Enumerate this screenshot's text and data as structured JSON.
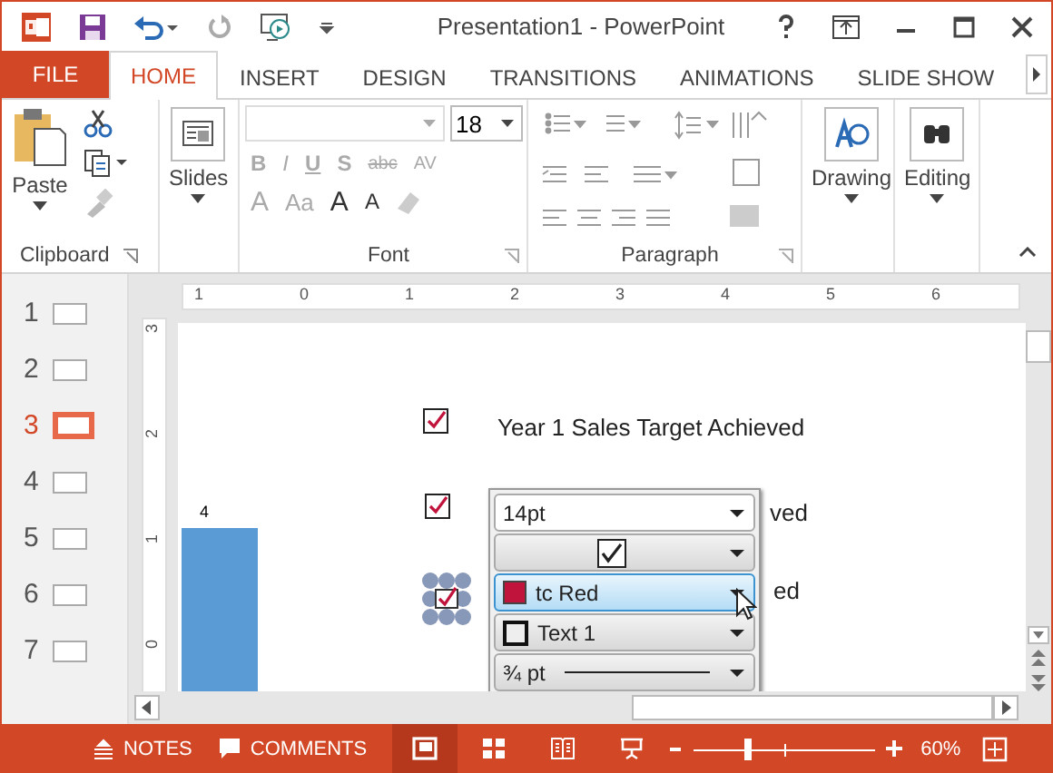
{
  "window": {
    "title": "Presentation1 - PowerPoint"
  },
  "tabs": [
    {
      "label": "FILE",
      "kind": "file",
      "selected": false
    },
    {
      "label": "HOME",
      "kind": "tab",
      "selected": true
    },
    {
      "label": "INSERT",
      "kind": "tab",
      "selected": false
    },
    {
      "label": "DESIGN",
      "kind": "tab",
      "selected": false
    },
    {
      "label": "TRANSITIONS",
      "kind": "tab",
      "selected": false
    },
    {
      "label": "ANIMATIONS",
      "kind": "tab",
      "selected": false
    },
    {
      "label": "SLIDE SHOW",
      "kind": "tab",
      "selected": false
    }
  ],
  "ribbon": {
    "clipboard": {
      "paste": "Paste",
      "group": "Clipboard"
    },
    "slides": {
      "label": "Slides"
    },
    "font": {
      "group": "Font",
      "size": "18",
      "format_buttons": [
        "B",
        "I",
        "U",
        "S",
        "abc",
        "AV"
      ],
      "case_buttons": [
        "A",
        "Aa"
      ],
      "grow_buttons": [
        "A",
        "A"
      ]
    },
    "paragraph": {
      "group": "Paragraph"
    },
    "drawing": {
      "label": "Drawing"
    },
    "editing": {
      "label": "Editing"
    }
  },
  "thumbnails": [
    {
      "number": "1",
      "selected": false
    },
    {
      "number": "2",
      "selected": false
    },
    {
      "number": "3",
      "selected": true
    },
    {
      "number": "4",
      "selected": false
    },
    {
      "number": "5",
      "selected": false
    },
    {
      "number": "6",
      "selected": false
    },
    {
      "number": "7",
      "selected": false
    }
  ],
  "ruler": {
    "horizontal": [
      "1",
      "0",
      "1",
      "2",
      "3",
      "4",
      "5",
      "6"
    ],
    "vertical": [
      "3",
      "2",
      "1",
      "0"
    ]
  },
  "slide": {
    "bar_label": "4",
    "rows": [
      {
        "checked": true,
        "selected": false,
        "text": "Year 1 Sales Target Achieved"
      },
      {
        "checked": true,
        "selected": false,
        "text": "ved"
      },
      {
        "checked": true,
        "selected": true,
        "text": "ed"
      }
    ]
  },
  "popup": {
    "font_size": "14pt",
    "color": {
      "label": "tc Red",
      "color": "#c0143c"
    },
    "border": {
      "label": "Text 1"
    },
    "weight": "¾ pt"
  },
  "status_bar": {
    "notes": "NOTES",
    "comments": "COMMENTS",
    "zoom": "60%",
    "zoom_slider": {
      "level": 0.3
    }
  }
}
